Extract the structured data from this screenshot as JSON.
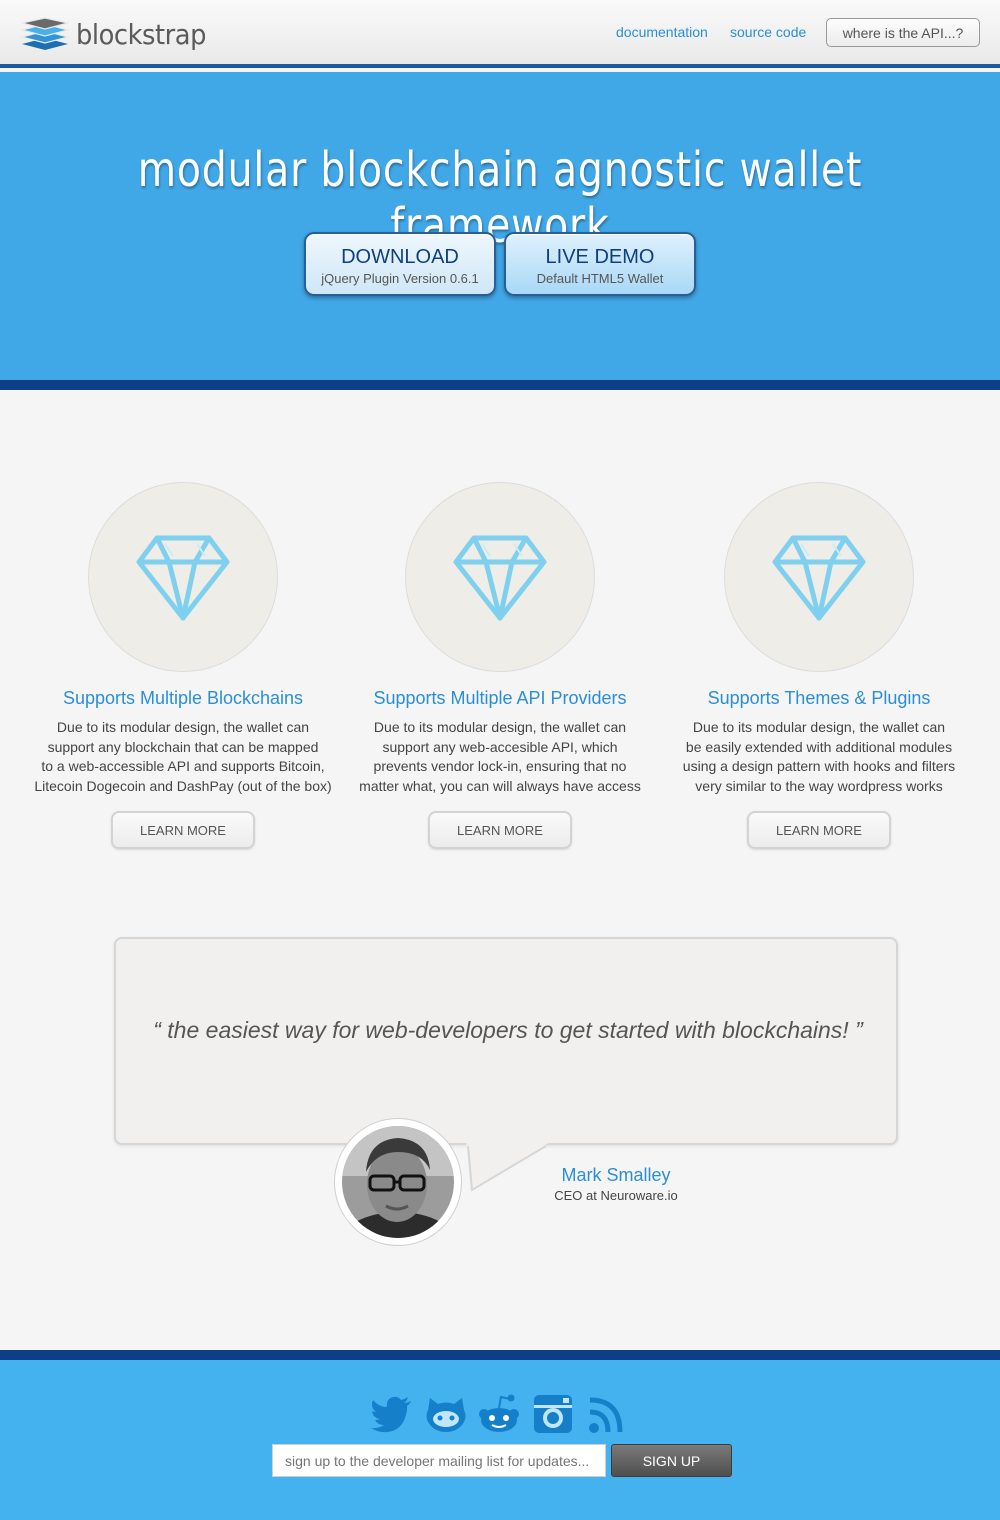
{
  "header": {
    "brand": "blockstrap",
    "nav": {
      "documentation": "documentation",
      "source_code": "source code"
    },
    "api_button": "where is the API...?"
  },
  "hero": {
    "title": "modular blockchain agnostic wallet framework",
    "download": {
      "label": "DOWNLOAD",
      "sub": "jQuery Plugin Version 0.6.1"
    },
    "demo": {
      "label": "LIVE DEMO",
      "sub": "Default HTML5 Wallet"
    }
  },
  "features": [
    {
      "icon": "diamond-icon",
      "title": "Supports Multiple Blockchains",
      "text": [
        "Due to its modular design, the wallet can",
        "support any blockchain that can be mapped",
        "to a web-accessible API and supports Bitcoin,",
        "Litecoin Dogecoin and DashPay (out of the box)"
      ],
      "button": "LEARN MORE"
    },
    {
      "icon": "diamond-icon",
      "title": "Supports Multiple API Providers",
      "text": [
        "Due to its modular design, the wallet can",
        "support any web-accesible API, which",
        "prevents vendor lock-in, ensuring that no",
        "matter what, you can will always have access"
      ],
      "button": "LEARN MORE"
    },
    {
      "icon": "diamond-icon",
      "title": "Supports Themes & Plugins",
      "text": [
        "Due to its modular design, the wallet can",
        "be easily extended with additional modules",
        "using a design pattern with hooks and filters",
        "very similar to the way wordpress works"
      ],
      "button": "LEARN MORE"
    }
  ],
  "testimonial": {
    "quote": "“ the easiest way for web-developers to get started with blockchains! ”",
    "name": "Mark Smalley",
    "role": "CEO at Neuroware.io"
  },
  "footer": {
    "social_icons": [
      "twitter-icon",
      "github-icon",
      "reddit-icon",
      "instagram-icon",
      "rss-icon"
    ],
    "email_placeholder": "sign up to the developer mailing list for updates...",
    "signup": "SIGN UP"
  },
  "colors": {
    "hero_blue": "#41a8e8",
    "dark_band": "#0e3f86",
    "link_blue": "#2a8fd6",
    "footer_blue": "#44b2ee"
  }
}
